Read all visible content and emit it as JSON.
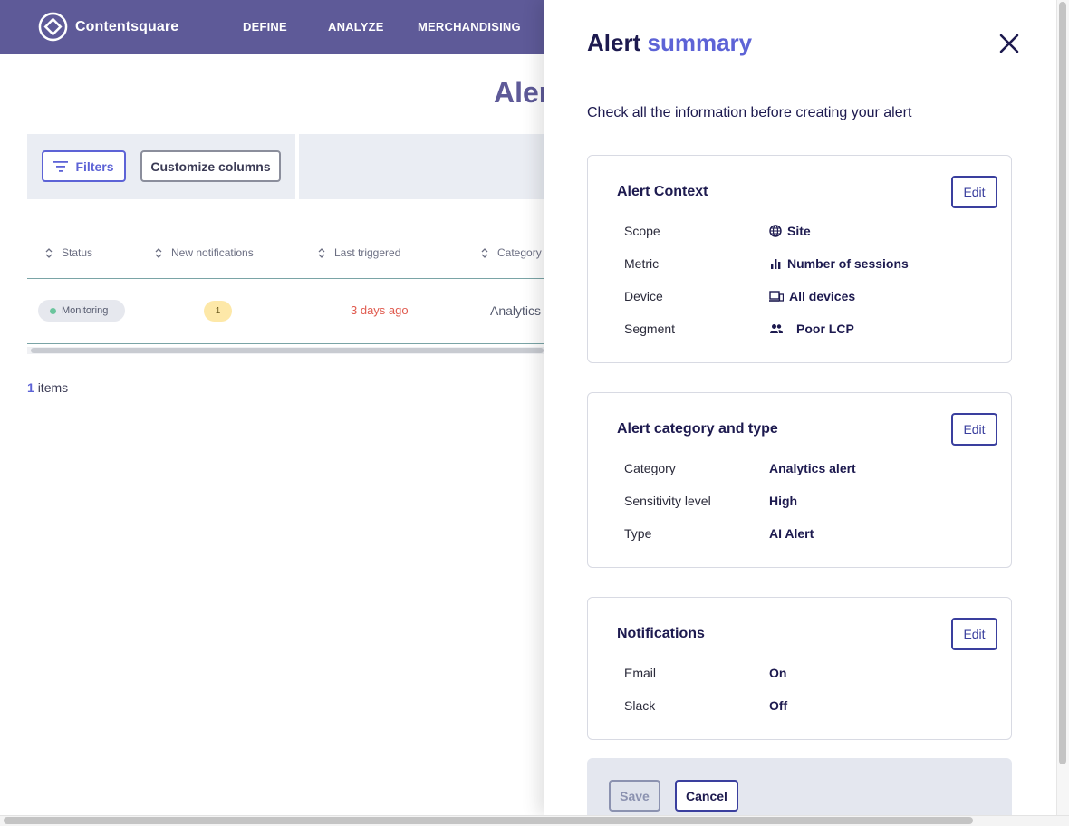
{
  "brand": {
    "name": "Contentsquare",
    "icon": "contentsquare-logo-icon",
    "nav_color": "#5e5a98"
  },
  "nav": {
    "items": [
      "DEFINE",
      "ANALYZE",
      "MERCHANDISING"
    ]
  },
  "page": {
    "title": "Alerts",
    "filters_label": "Filters",
    "customize_label": "Customize columns",
    "columns": [
      "Status",
      "New notifications",
      "Last triggered",
      "Category"
    ],
    "rows": [
      {
        "status": "Monitoring",
        "new_notifications": "1",
        "last_triggered": "3 days ago",
        "category": "Analytics"
      }
    ],
    "items_count": "1",
    "items_suffix": "items"
  },
  "drawer": {
    "title_prefix": "Alert",
    "title_accent": "summary",
    "subtitle": "Check all the information before creating your alert",
    "edit_label": "Edit",
    "context": {
      "title": "Alert Context",
      "rows": [
        {
          "label": "Scope",
          "value": "Site",
          "icon": "globe-icon"
        },
        {
          "label": "Metric",
          "value": "Number of sessions",
          "icon": "bar-chart-icon"
        },
        {
          "label": "Device",
          "value": "All devices",
          "icon": "devices-icon"
        },
        {
          "label": "Segment",
          "value": "Poor LCP",
          "icon": "users-icon"
        }
      ]
    },
    "category": {
      "title": "Alert category and type",
      "rows": [
        {
          "label": "Category",
          "value": "Analytics alert"
        },
        {
          "label": "Sensitivity level",
          "value": "High"
        },
        {
          "label": "Type",
          "value": "AI Alert"
        }
      ]
    },
    "notifications": {
      "title": "Notifications",
      "rows": [
        {
          "label": "Email",
          "value": "On"
        },
        {
          "label": "Slack",
          "value": "Off"
        }
      ]
    },
    "save_label": "Save",
    "cancel_label": "Cancel"
  },
  "colors": {
    "accent": "#5d63d6",
    "dark_text": "#1d1a4f",
    "warning": "#e05a4e",
    "monitoring": "#6bc59d"
  }
}
